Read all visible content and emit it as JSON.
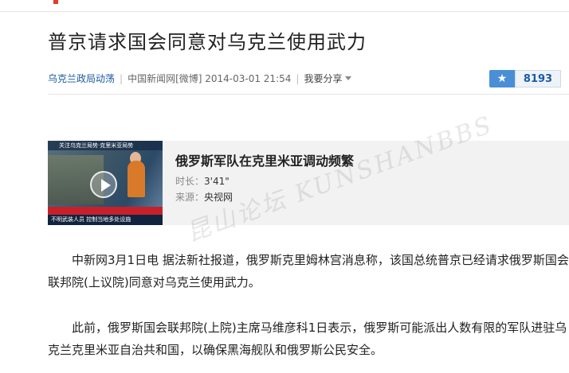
{
  "article": {
    "title": "普京请求国会同意对乌克兰使用武力",
    "category": "乌克兰政局动荡",
    "source_line": "中国新闻网[微博] 2014-03-01 21:54",
    "share_label": "我要分享",
    "counter": "8193"
  },
  "video": {
    "title": "俄罗斯军队在克里米亚调动频繁",
    "duration_label": "时长：",
    "duration_value": "3'41\"",
    "source_label": "来源：",
    "source_value": "央视网",
    "thumb_top_text": "关注乌克兰局势·克里米亚局势",
    "thumb_bottom_text": "不明武装人员 控制当地多处设施"
  },
  "watermark": "昆山论坛 KUNSHANBBS",
  "body": {
    "p1": "中新网3月1日电 据法新社报道，俄罗斯克里姆林宫消息称，该国总统普京已经请求俄罗斯国会联邦院(上议院)同意对乌克兰使用武力。",
    "p2": "此前，俄罗斯国会联邦院(上院)主席马维彦科1日表示，俄罗斯可能派出人数有限的军队进驻乌克兰克里米亚自治共和国，以确保黑海舰队和俄罗斯公民安全。"
  },
  "colors": {
    "accent_blue": "#1a5aa6",
    "counter_icon": "#4a8fd6",
    "news_red": "#c8202b"
  }
}
